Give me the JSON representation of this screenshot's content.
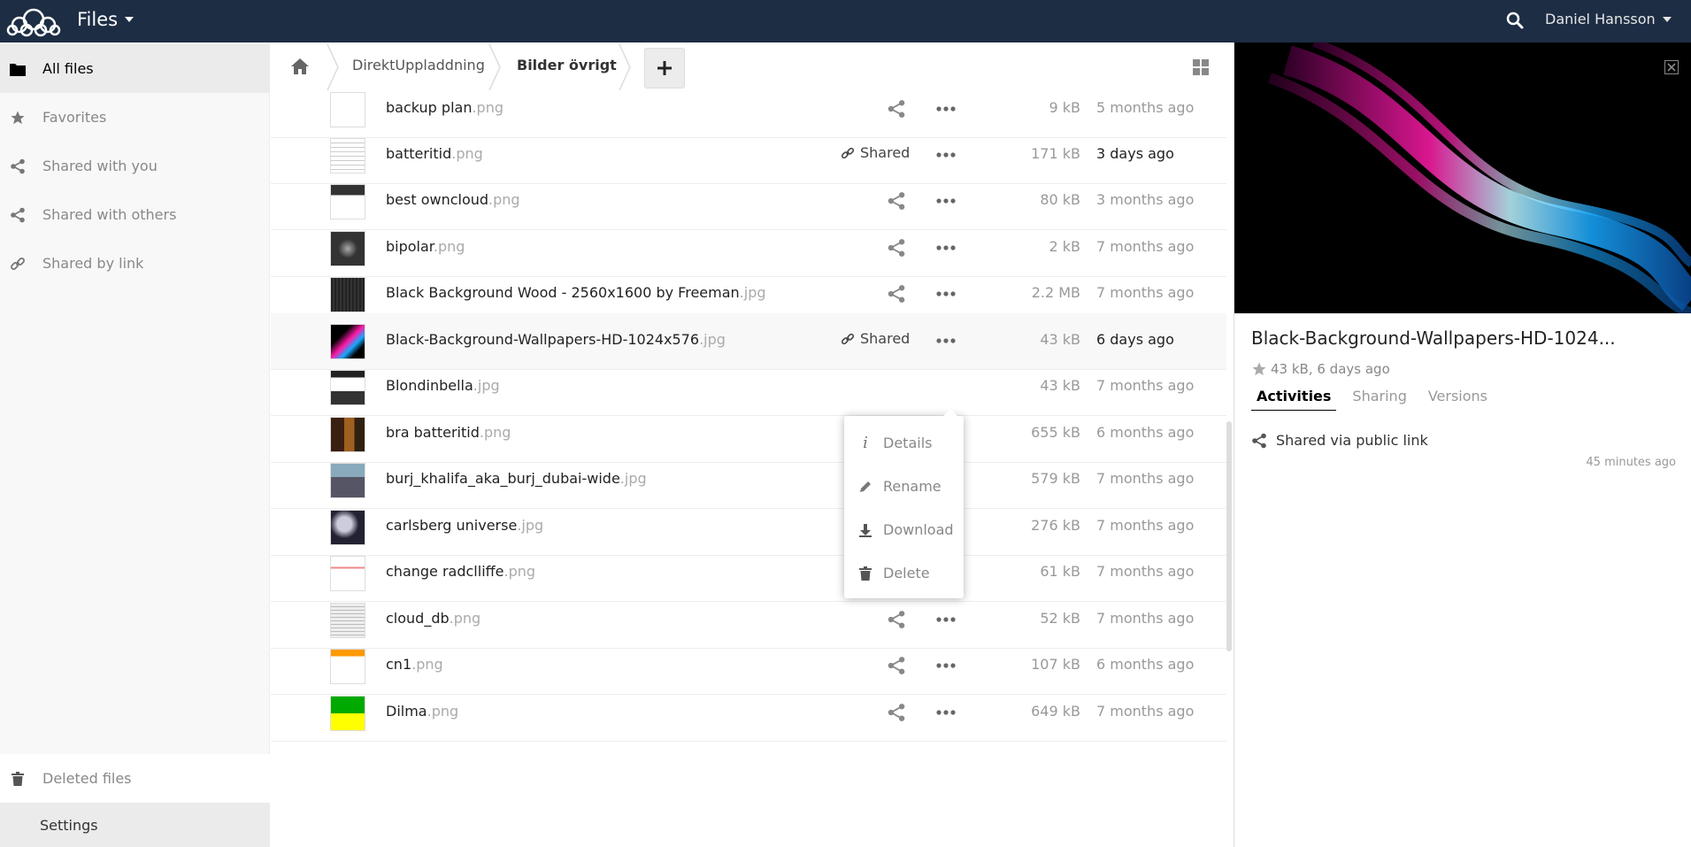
{
  "header": {
    "app_name": "Files",
    "user": "Daniel Hansson"
  },
  "sidebar": {
    "items": [
      {
        "label": "All files",
        "icon": "folder-icon"
      },
      {
        "label": "Favorites",
        "icon": "star-icon"
      },
      {
        "label": "Shared with you",
        "icon": "share-icon"
      },
      {
        "label": "Shared with others",
        "icon": "share-icon"
      },
      {
        "label": "Shared by link",
        "icon": "link-icon"
      }
    ],
    "deleted": "Deleted files",
    "settings": "Settings"
  },
  "breadcrumb": {
    "items": [
      "DirektUppladdning",
      "Bilder övrigt"
    ]
  },
  "files": [
    {
      "name": "backup plan",
      "ext": ".png",
      "size": "9 kB",
      "date": "5 months ago"
    },
    {
      "name": "batteritid",
      "ext": ".png",
      "size": "171 kB",
      "date": "3 days ago",
      "shared": "Shared"
    },
    {
      "name": "best owncloud",
      "ext": ".png",
      "size": "80 kB",
      "date": "3 months ago"
    },
    {
      "name": "bipolar",
      "ext": ".png",
      "size": "2 kB",
      "date": "7 months ago"
    },
    {
      "name": "Black Background Wood - 2560x1600 by Freeman",
      "ext": ".jpg",
      "size": "2.2 MB",
      "date": "7 months ago"
    },
    {
      "name": "Black-Background-Wallpapers-HD-1024x576",
      "ext": ".jpg",
      "size": "43 kB",
      "date": "6 days ago",
      "shared": "Shared"
    },
    {
      "name": "Blondinbella",
      "ext": ".jpg",
      "size": "43 kB",
      "date": "7 months ago"
    },
    {
      "name": "bra batteritid",
      "ext": ".png",
      "size": "655 kB",
      "date": "6 months ago"
    },
    {
      "name": "burj_khalifa_aka_burj_dubai-wide",
      "ext": ".jpg",
      "size": "579 kB",
      "date": "7 months ago"
    },
    {
      "name": "carlsberg universe",
      "ext": ".jpg",
      "size": "276 kB",
      "date": "7 months ago"
    },
    {
      "name": "change radclliffe",
      "ext": ".png",
      "size": "61 kB",
      "date": "7 months ago"
    },
    {
      "name": "cloud_db",
      "ext": ".png",
      "size": "52 kB",
      "date": "7 months ago"
    },
    {
      "name": "cn1",
      "ext": ".png",
      "size": "107 kB",
      "date": "6 months ago"
    },
    {
      "name": "Dilma",
      "ext": ".png",
      "size": "649 kB",
      "date": "7 months ago"
    }
  ],
  "menu": {
    "details": "Details",
    "rename": "Rename",
    "download": "Download",
    "delete": "Delete"
  },
  "details_panel": {
    "title": "Black-Background-Wallpapers-HD-1024...",
    "meta": "43 kB, 6 days ago",
    "tabs": [
      "Activities",
      "Sharing",
      "Versions"
    ],
    "activity": "Shared via public link",
    "activity_time": "45 minutes ago"
  },
  "colors": {
    "header_bg": "#1d2d44",
    "sidebar_bg": "#f8f8f8",
    "active_bg": "#ebebeb"
  }
}
